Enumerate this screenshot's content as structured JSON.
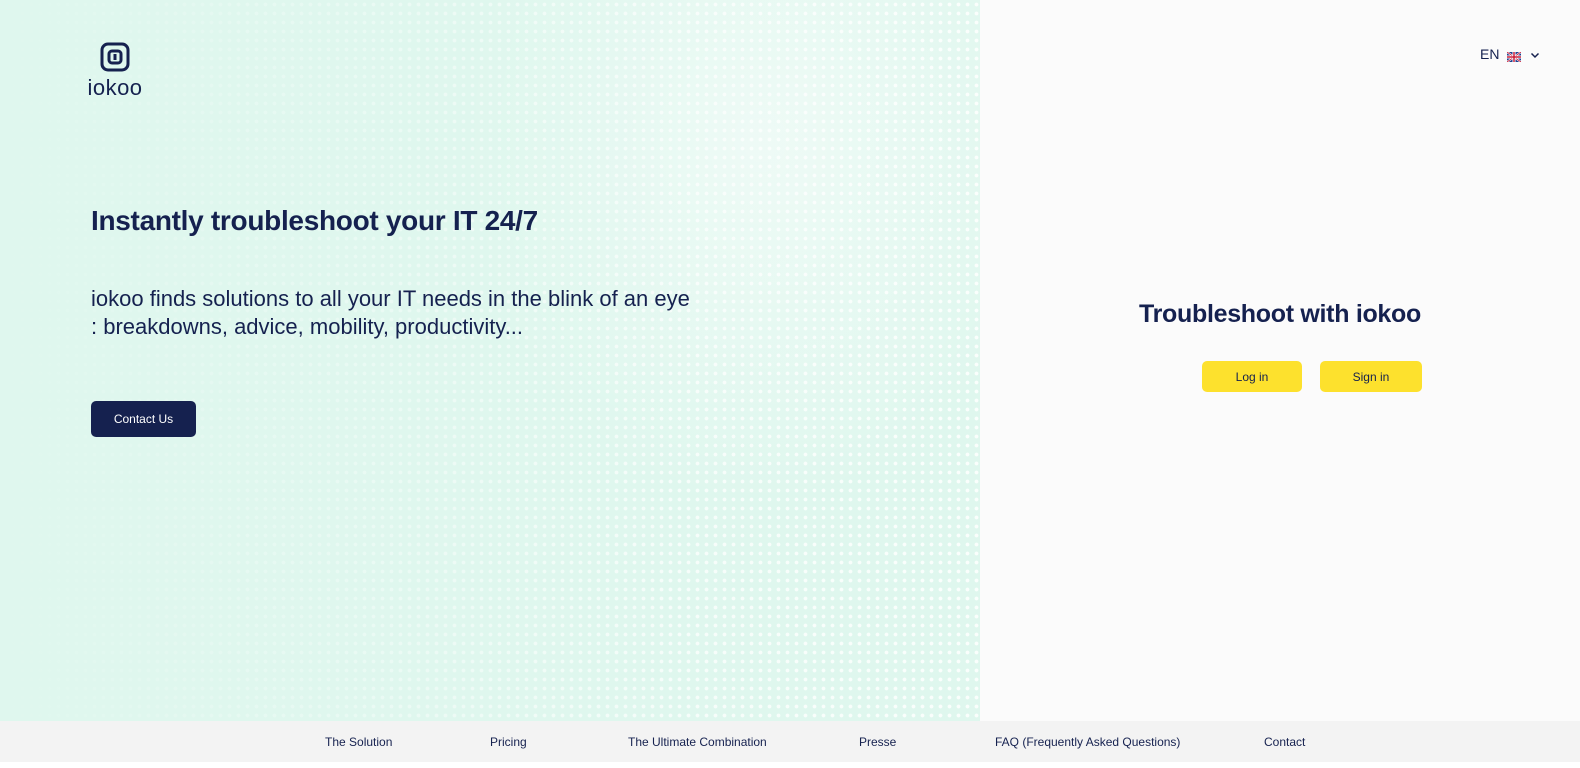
{
  "brand": {
    "name": "iokoo"
  },
  "language": {
    "code": "EN",
    "flag_icon": "uk-flag-icon"
  },
  "hero": {
    "title": "Instantly troubleshoot your IT 24/7",
    "subtitle": "iokoo finds solutions to all your IT needs in the blink of an eye : breakdowns, advice, mobility, productivity...",
    "cta_label": "Contact Us"
  },
  "auth": {
    "title": "Troubleshoot with iokoo",
    "login_label": "Log in",
    "signup_label": "Sign in"
  },
  "footer": {
    "links": [
      "The Solution",
      "Pricing",
      "The Ultimate Combination",
      "Presse",
      "FAQ (Frequently Asked Questions)",
      "Contact"
    ]
  },
  "colors": {
    "navy": "#15214f",
    "mint_background": "#dff7ee",
    "yellow_button": "#fde12d",
    "footer_background": "#f3f3f3"
  }
}
